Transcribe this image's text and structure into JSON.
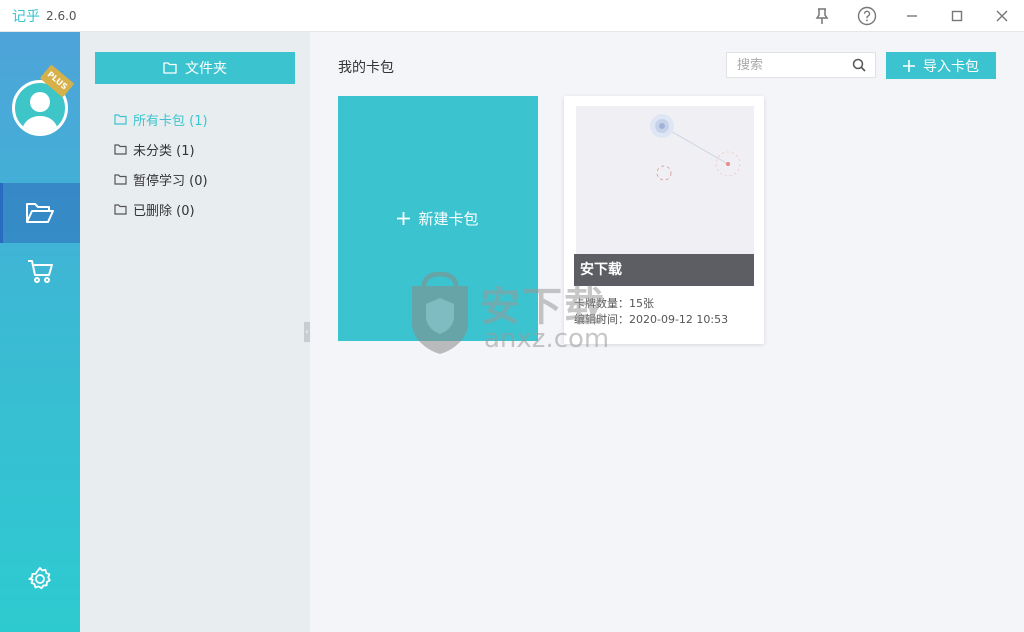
{
  "window": {
    "app_name": "记乎",
    "version": "2.6.0"
  },
  "rail": {
    "badge_text": "PLUS",
    "items": [
      {
        "name": "folders",
        "icon": "folder-open-icon",
        "active": true
      },
      {
        "name": "store",
        "icon": "cart-icon",
        "active": false
      }
    ],
    "settings_icon": "gear-icon"
  },
  "folders": {
    "button_label": "文件夹",
    "items": [
      {
        "label": "所有卡包 (1)",
        "active": true
      },
      {
        "label": "未分类 (1)",
        "active": false
      },
      {
        "label": "暂停学习 (0)",
        "active": false
      },
      {
        "label": "已删除 (0)",
        "active": false
      }
    ]
  },
  "main": {
    "title": "我的卡包",
    "search_placeholder": "搜索",
    "import_label": "导入卡包",
    "new_card_label": "新建卡包",
    "cards": [
      {
        "name": "安下载",
        "count_text": "卡牌数量：15张",
        "edit_time_text": "编辑时间：2020-09-12 10:53"
      }
    ]
  },
  "watermark": {
    "text": "安下载",
    "domain": "anxz.com"
  },
  "colors": {
    "accent": "#3bc4cf",
    "rail_top": "#4ea3d9",
    "rail_bottom": "#2dcbd0",
    "panel_bg": "#e8edf0",
    "main_bg": "#f4f5f9",
    "card_bar": "#5d5e64"
  }
}
